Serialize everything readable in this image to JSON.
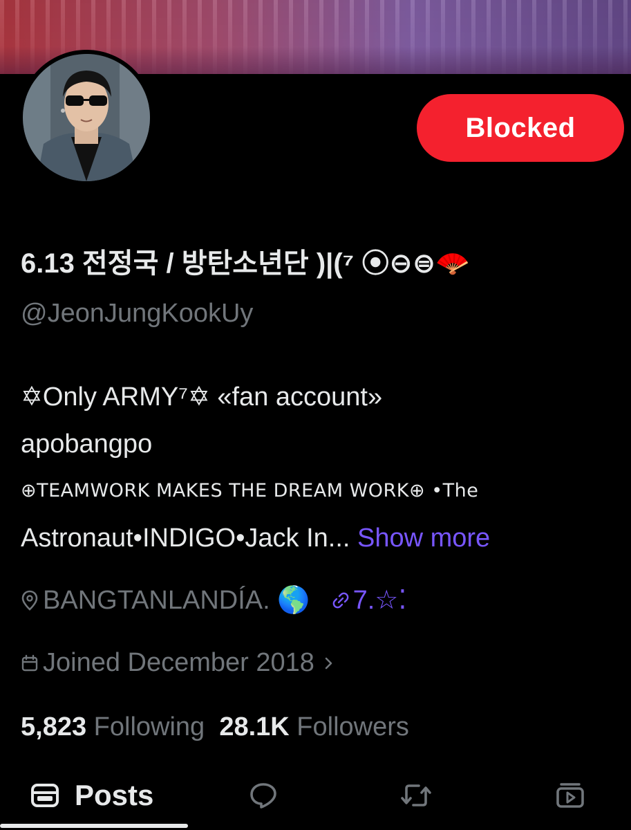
{
  "profile": {
    "display_name": "6.13 전정국 / 방탄소년단 )|(⁷ ⦿⊖⊜🪭",
    "handle": "@JeonJungKookUy",
    "blocked_label": "Blocked",
    "bio_lines": [
      "✡Only ARMY⁷✡ «fan account»",
      "apobangpo",
      "⊕TEAMWORK MAKES THE DREAM WORK⊕ •The",
      "Astronaut•INDIGO•Jack In..."
    ],
    "show_more_label": "Show more",
    "location": "BANGTANLANDÍA. 🌎",
    "link": "7.☆⁚",
    "joined": "Joined December 2018",
    "following_count": "5,823",
    "following_label": "Following",
    "followers_count": "28.1K",
    "followers_label": "Followers"
  },
  "tabs": {
    "posts_label": "Posts"
  },
  "icons": {
    "location": "location-pin-icon",
    "link": "link-icon",
    "calendar": "calendar-icon",
    "chevron": "chevron-right-icon",
    "posts": "posts-icon",
    "replies": "reply-icon",
    "reposts": "repost-icon",
    "media": "media-icon"
  },
  "colors": {
    "background": "#000000",
    "primary_text": "#e7e9ea",
    "secondary_text": "#71767b",
    "blocked_button": "#f4212e",
    "accent_link": "#7856ff"
  }
}
